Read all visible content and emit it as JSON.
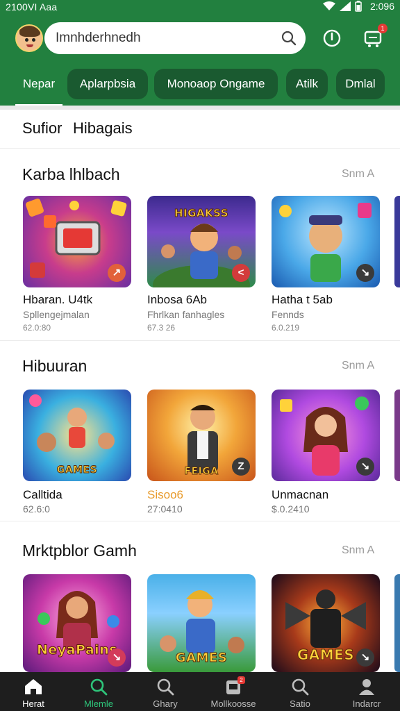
{
  "status_bar": {
    "left_text": "2100VI Aaa",
    "time": "2:096"
  },
  "search": {
    "placeholder": "Imnhderhnedh"
  },
  "header": {
    "cart_badge": "1"
  },
  "tabs": [
    {
      "label": "Nepar",
      "active": true
    },
    {
      "label": "Aplarpbsia",
      "active": false
    },
    {
      "label": "Monoaop Ongame",
      "active": false
    },
    {
      "label": "Atilk",
      "active": false
    },
    {
      "label": "Dmlal",
      "active": false
    }
  ],
  "subheader": {
    "left": "Sufior",
    "right": "Hibagais"
  },
  "sections": [
    {
      "title": "Karba lhlbach",
      "see_all": "Snm A",
      "cards": [
        {
          "title": "Hbaran. U4tk",
          "subtitle": "Spllengejmalan",
          "meta": "62.0:80",
          "thumb_word": "",
          "badge": "↗"
        },
        {
          "title": "Inbosa 6Ab",
          "subtitle": "Fhrlkan fanhagles",
          "meta": "67.3 26",
          "thumb_word": "HIGAKSS",
          "badge": "<"
        },
        {
          "title": "Hatha t 5ab",
          "subtitle": "Fennds",
          "meta": "6.0.219",
          "thumb_word": "",
          "badge": "↘"
        }
      ]
    },
    {
      "title": "Hibuuran",
      "see_all": "Snm A",
      "cards": [
        {
          "title": "Calltida",
          "subtitle": "62.6:0",
          "meta": "",
          "thumb_word": "GAMES",
          "badge": ""
        },
        {
          "title": "Sisoo6",
          "subtitle": "27:0410",
          "meta": "",
          "thumb_word": "FEIGA",
          "badge": "Z"
        },
        {
          "title": "Unmacnan",
          "subtitle": "$.0.2410",
          "meta": "",
          "thumb_word": "",
          "badge": "↘"
        }
      ]
    },
    {
      "title": "Mrktpblor Gamh",
      "see_all": "Snm A",
      "cards": [
        {
          "title": "",
          "subtitle": "",
          "meta": "",
          "thumb_word": "NeyaPains",
          "badge": "↘"
        },
        {
          "title": "",
          "subtitle": "",
          "meta": "",
          "thumb_word": "GAMES",
          "badge": ""
        },
        {
          "title": "",
          "subtitle": "",
          "meta": "",
          "thumb_word": "GAMES",
          "badge": "↘"
        }
      ]
    }
  ],
  "bottom_nav": [
    {
      "label": "Herat",
      "icon": "home-icon"
    },
    {
      "label": "Mlemle",
      "icon": "search-icon"
    },
    {
      "label": "Ghary",
      "icon": "search-icon"
    },
    {
      "label": "Mollkoosse",
      "icon": "bag-icon",
      "badge": "2"
    },
    {
      "label": "Satio",
      "icon": "search-icon"
    },
    {
      "label": "Indarcr",
      "icon": "profile-icon"
    }
  ],
  "colors": {
    "primary": "#22803f",
    "tab_dark": "#1a5a30",
    "accent": "#2ec47a",
    "nav_bg": "#1e1e1e"
  }
}
